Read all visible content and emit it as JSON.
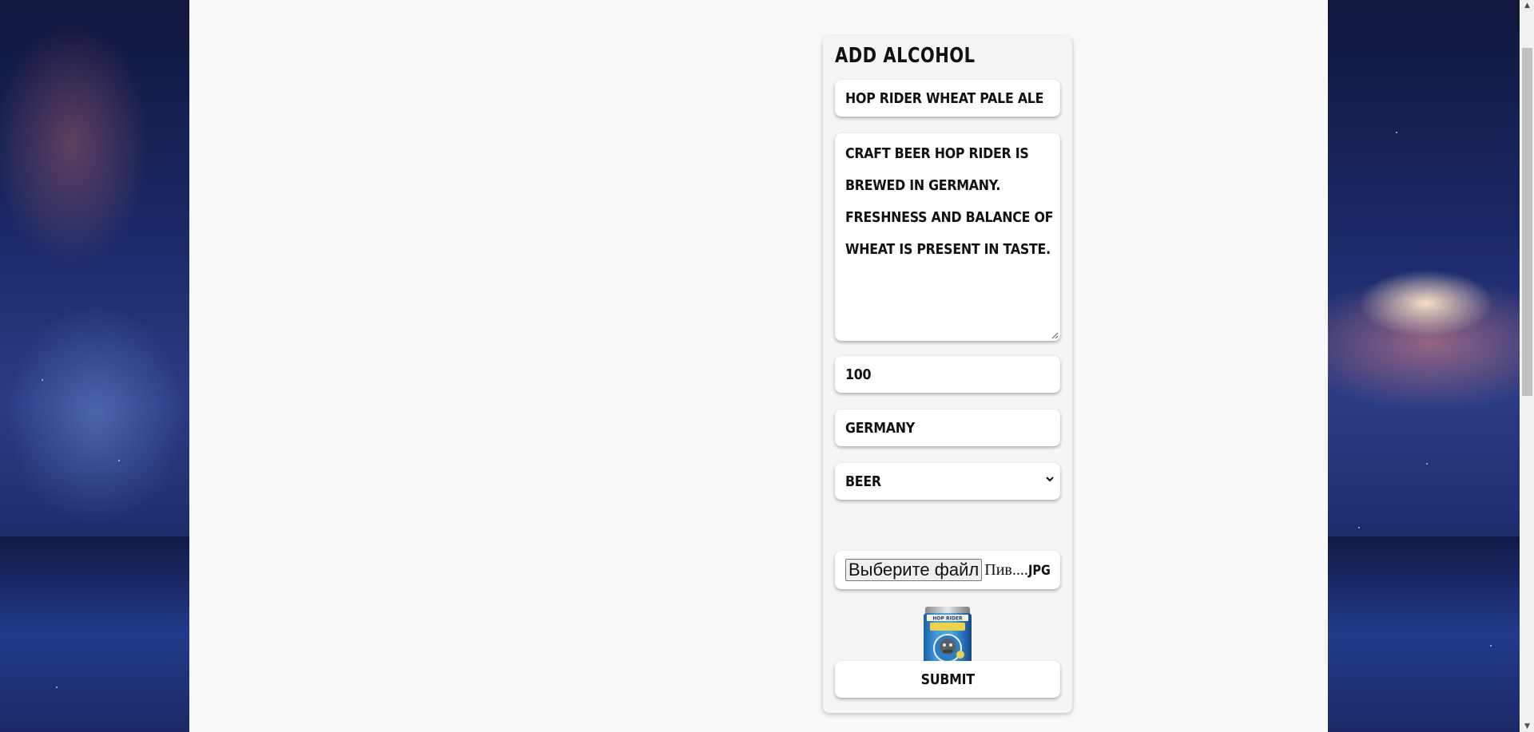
{
  "form": {
    "title": "ADD ALCOHOL",
    "name_value": "HOP RIDER WHEAT PALE ALE",
    "description_value": "CRAFT BEER HOP RIDER IS BREWED IN GERMANY. FRESHNESS AND BALANCE OF WHEAT IS PRESENT IN TASTE.",
    "price_value": "100",
    "country_value": "GERMANY",
    "category_selected": "BEER",
    "file_button_label": "Выберите файл",
    "file_name_prefix": "Пив....",
    "file_name_ext": "JPG",
    "preview_label": "HOP RIDER",
    "submit_label": "SUBMIT"
  },
  "icons": {
    "select_arrow": "chevron-down-icon",
    "resize": "resize-grip-icon",
    "scroll_up": "scroll-up-arrow-icon",
    "scroll_down": "scroll-down-arrow-icon"
  },
  "colors": {
    "page_background": "#f9f9f9",
    "card_background": "#f5f5f5",
    "field_background": "#ffffff",
    "text": "#111111"
  }
}
